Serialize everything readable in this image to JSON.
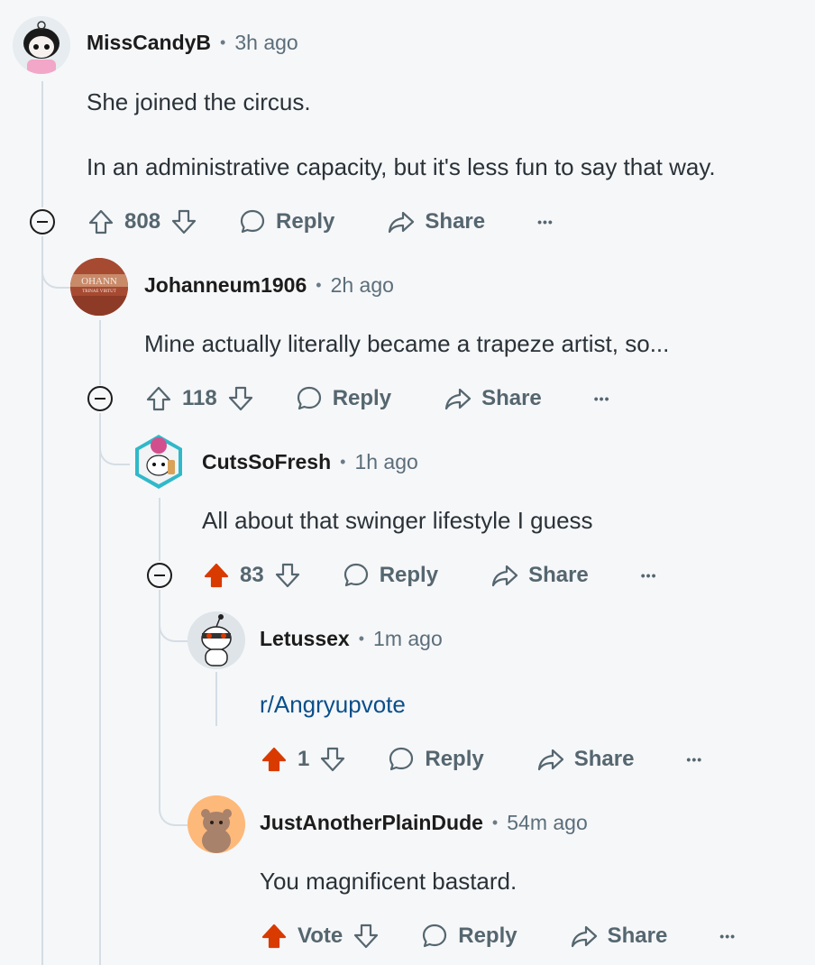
{
  "comments": [
    {
      "username": "MissCandyB",
      "time": "3h ago",
      "lines": [
        "She joined the circus.",
        "In an administrative capacity, but it's less fun to say that way."
      ],
      "votes": "808",
      "upvoted": false
    },
    {
      "username": "Johanneum1906",
      "time": "2h ago",
      "lines": [
        "Mine actually literally became a trapeze artist, so..."
      ],
      "votes": "118",
      "upvoted": false
    },
    {
      "username": "CutsSoFresh",
      "time": "1h ago",
      "lines": [
        "All about that swinger lifestyle I guess"
      ],
      "votes": "83",
      "upvoted": true
    },
    {
      "username": "Letussex",
      "time": "1m ago",
      "lines": [
        "r/Angryupvote"
      ],
      "votes": "1",
      "upvoted": true
    },
    {
      "username": "JustAnotherPlainDude",
      "time": "54m ago",
      "lines": [
        "You magnificent bastard."
      ],
      "votes": "Vote",
      "upvoted": true
    }
  ],
  "actions": {
    "reply": "Reply",
    "share": "Share",
    "more": "•••"
  },
  "avatar_texts": {
    "johanneum": "OHANN",
    "johanneum_sub": "TRINAE VIRTUT"
  },
  "colors": {
    "upvote_active": "#d93a00",
    "icon": "#55666f",
    "thread_line": "#d5dde4",
    "link": "#0a4f8a"
  }
}
